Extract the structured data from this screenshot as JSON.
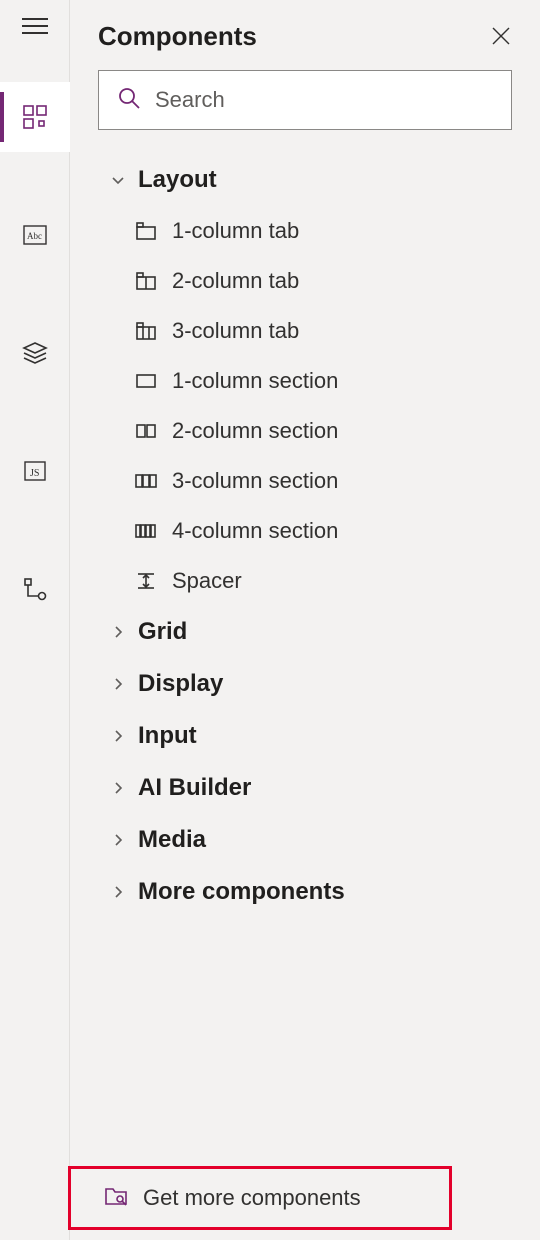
{
  "panel": {
    "title": "Components",
    "search_placeholder": "Search"
  },
  "nav": {
    "items": [
      {
        "name": "components",
        "selected": true
      },
      {
        "name": "abc",
        "selected": false
      },
      {
        "name": "layers",
        "selected": false
      },
      {
        "name": "js",
        "selected": false
      },
      {
        "name": "flow",
        "selected": false
      }
    ]
  },
  "tree": {
    "groups": [
      {
        "name": "layout",
        "label": "Layout",
        "expanded": true,
        "items": [
          {
            "name": "1-column-tab",
            "label": "1-column tab",
            "icon": "tab-1"
          },
          {
            "name": "2-column-tab",
            "label": "2-column tab",
            "icon": "tab-2"
          },
          {
            "name": "3-column-tab",
            "label": "3-column tab",
            "icon": "tab-3"
          },
          {
            "name": "1-column-section",
            "label": "1-column section",
            "icon": "sec-1"
          },
          {
            "name": "2-column-section",
            "label": "2-column section",
            "icon": "sec-2"
          },
          {
            "name": "3-column-section",
            "label": "3-column section",
            "icon": "sec-3"
          },
          {
            "name": "4-column-section",
            "label": "4-column section",
            "icon": "sec-4"
          },
          {
            "name": "spacer",
            "label": "Spacer",
            "icon": "spacer"
          }
        ]
      },
      {
        "name": "grid",
        "label": "Grid",
        "expanded": false,
        "items": []
      },
      {
        "name": "display",
        "label": "Display",
        "expanded": false,
        "items": []
      },
      {
        "name": "input",
        "label": "Input",
        "expanded": false,
        "items": []
      },
      {
        "name": "ai-builder",
        "label": "AI Builder",
        "expanded": false,
        "items": []
      },
      {
        "name": "media",
        "label": "Media",
        "expanded": false,
        "items": []
      },
      {
        "name": "more-components",
        "label": "More components",
        "expanded": false,
        "items": []
      }
    ]
  },
  "footer": {
    "label": "Get more components"
  },
  "colors": {
    "accent": "#742774",
    "highlight": "#e3002b"
  }
}
